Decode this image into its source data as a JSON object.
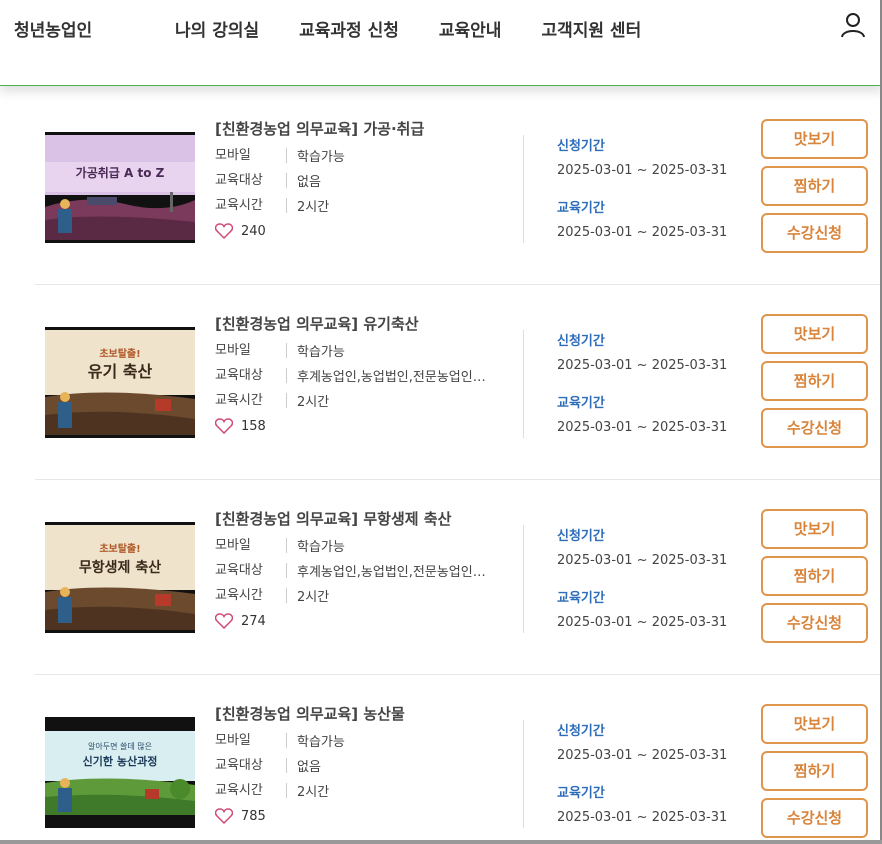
{
  "header": {
    "brand": "청년농업인",
    "nav": [
      "나의 강의실",
      "교육과정 신청",
      "교육안내",
      "고객지원 센터"
    ]
  },
  "labels": {
    "device": "모바일",
    "target": "교육대상",
    "hours": "교육시간",
    "apply_period": "신청기간",
    "edu_period": "교육기간",
    "preview": "맛보기",
    "wishlist": "찜하기",
    "enroll": "수강신청"
  },
  "courses": [
    {
      "title": "[친환경농업 의무교육] 가공·취급",
      "device_status": "학습가능",
      "target": "없음",
      "hours": "2시간",
      "likes": "240",
      "apply_period": "2025-03-01 ~ 2025-03-31",
      "edu_period": "2025-03-01 ~ 2025-03-31",
      "thumb_line1": "",
      "thumb_line2": "가공취급 A to Z"
    },
    {
      "title": "[친환경농업 의무교육] 유기축산",
      "device_status": "학습가능",
      "target": "후계농업인,농업법인,전문농업인,청년농업인",
      "hours": "2시간",
      "likes": "158",
      "apply_period": "2025-03-01 ~ 2025-03-31",
      "edu_period": "2025-03-01 ~ 2025-03-31",
      "thumb_line1": "초보탈출!",
      "thumb_line2": "유기 축산"
    },
    {
      "title": "[친환경농업 의무교육] 무항생제 축산",
      "device_status": "학습가능",
      "target": "후계농업인,농업법인,전문농업인,청년농업인",
      "hours": "2시간",
      "likes": "274",
      "apply_period": "2025-03-01 ~ 2025-03-31",
      "edu_period": "2025-03-01 ~ 2025-03-31",
      "thumb_line1": "초보탈출!",
      "thumb_line2": "무항생제 축산"
    },
    {
      "title": "[친환경농업 의무교육] 농산물",
      "device_status": "학습가능",
      "target": "없음",
      "hours": "2시간",
      "likes": "785",
      "apply_period": "2025-03-01 ~ 2025-03-31",
      "edu_period": "2025-03-01 ~ 2025-03-31",
      "thumb_line1": "알아두면 쓸데 많은",
      "thumb_line2": "신기한 농산과정"
    }
  ],
  "colors": {
    "accent_orange": "#e0954d",
    "period_blue": "#2e6dba",
    "header_line": "#4caf50"
  },
  "icons": {
    "user": "user-icon",
    "heart": "heart-icon"
  }
}
